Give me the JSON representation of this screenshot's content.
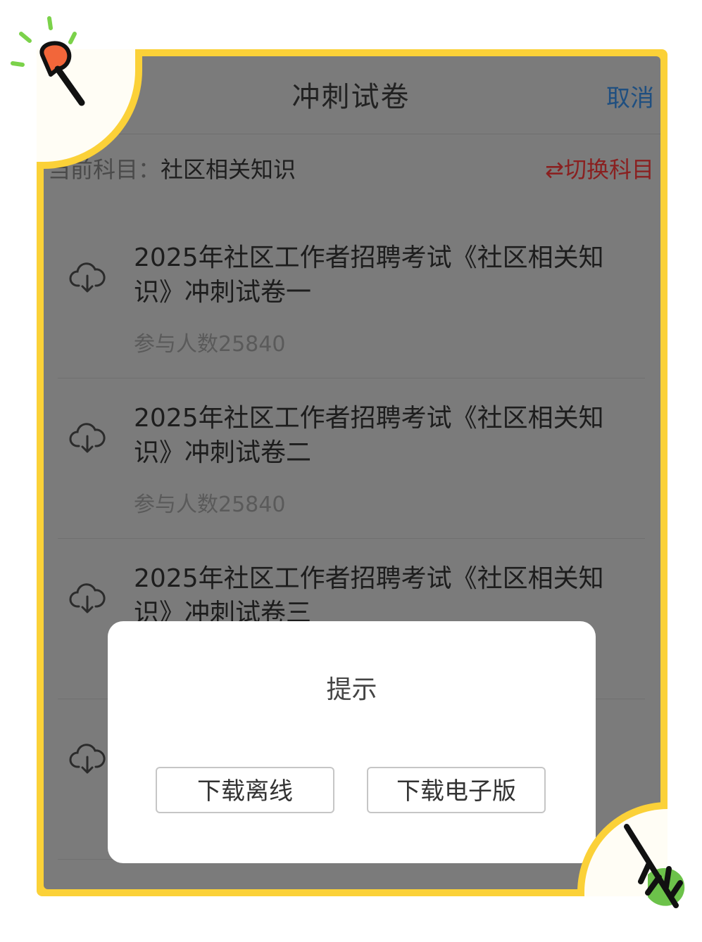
{
  "nav": {
    "title": "冲刺试卷",
    "cancel_label": "取消"
  },
  "subject": {
    "prefix": "当前科目：",
    "name": "社区相关知识",
    "switch_label": "⇄切换科目"
  },
  "papers": [
    {
      "title": "2025年社区工作者招聘考试《社区相关知识》冲刺试卷一",
      "participants": "参与人数25840"
    },
    {
      "title": "2025年社区工作者招聘考试《社区相关知识》冲刺试卷二",
      "participants": "参与人数25840"
    },
    {
      "title": "2025年社区工作者招聘考试《社区相关知识》冲刺试卷三",
      "participants": ""
    },
    {
      "title": "",
      "participants": ""
    }
  ],
  "dialog": {
    "title": "提示",
    "offline_label": "下载离线",
    "ebook_label": "下载电子版"
  },
  "icons": {
    "download": "cloud-download-icon"
  },
  "colors": {
    "frame": "#fbd138",
    "overlay": "#7b7b7b",
    "cancel": "#1f4f80",
    "switch": "#8a2020"
  }
}
